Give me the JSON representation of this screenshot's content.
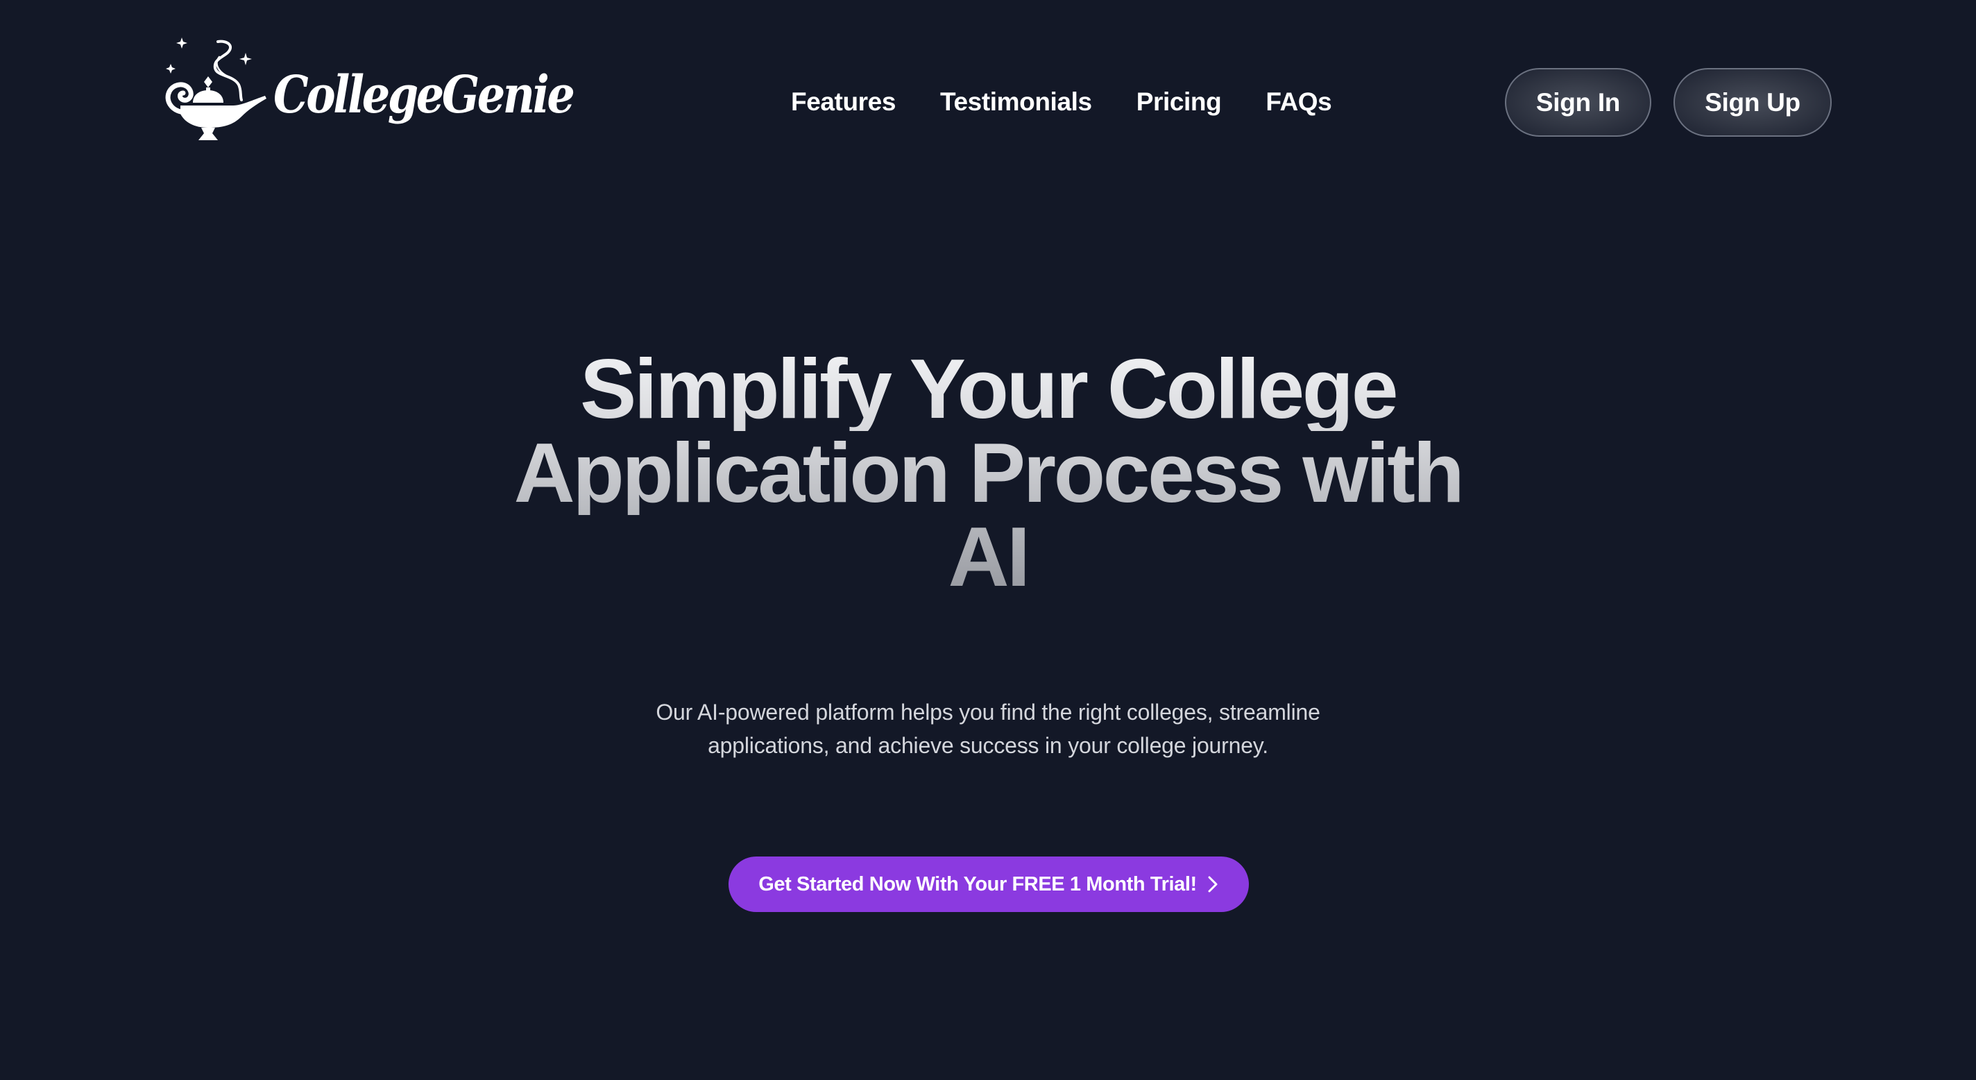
{
  "brand": {
    "name": "CollegeGenie",
    "logo_icon": "magic-lamp-icon"
  },
  "nav": {
    "items": [
      {
        "label": "Features"
      },
      {
        "label": "Testimonials"
      },
      {
        "label": "Pricing"
      },
      {
        "label": "FAQs"
      }
    ]
  },
  "auth": {
    "sign_in_label": "Sign In",
    "sign_up_label": "Sign Up"
  },
  "hero": {
    "title_lines": [
      "Simplify Your College",
      "Application Process with",
      "AI"
    ],
    "subtitle_lines": [
      "Our AI-powered platform helps you find the right colleges, streamline",
      "applications, and achieve success in your college journey."
    ],
    "cta_label": "Get Started Now With Your FREE 1 Month Trial!",
    "cta_icon": "chevron-right-icon"
  },
  "colors": {
    "background": "#131827",
    "accent": "#8b3ae0",
    "button_border": "#6b7180",
    "subtitle_text": "#d4d6dc",
    "title_gradient_top": "#f1f2f4",
    "title_gradient_bottom": "#96989f"
  }
}
